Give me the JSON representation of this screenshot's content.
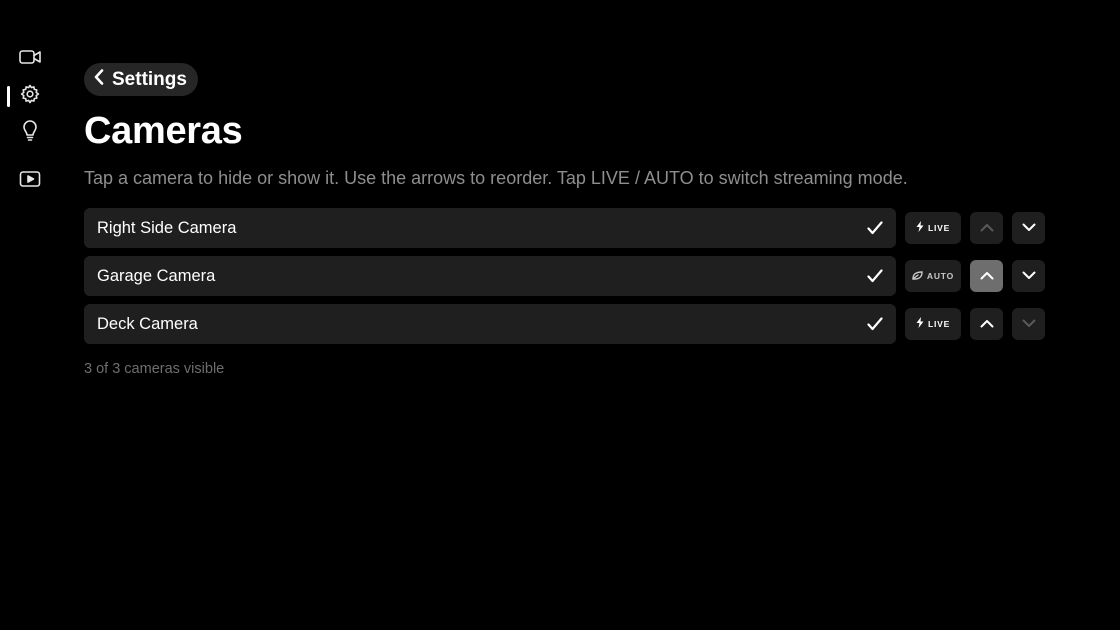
{
  "sidebar": {
    "items": [
      {
        "icon": "video-camera-icon"
      },
      {
        "icon": "gear-icon",
        "selected": true
      },
      {
        "icon": "lightbulb-icon"
      },
      {
        "icon": "play-icon"
      }
    ]
  },
  "header": {
    "back_label": "Settings",
    "title": "Cameras",
    "subtitle": "Tap a camera to hide or show it. Use the arrows to reorder. Tap LIVE / AUTO to switch streaming mode."
  },
  "cameras": [
    {
      "name": "Right Side Camera",
      "visible": true,
      "mode": "LIVE",
      "up_enabled": false,
      "down_enabled": true
    },
    {
      "name": "Garage Camera",
      "visible": true,
      "mode": "AUTO",
      "up_enabled": true,
      "down_enabled": true
    },
    {
      "name": "Deck Camera",
      "visible": true,
      "mode": "LIVE",
      "up_enabled": true,
      "down_enabled": false
    }
  ],
  "footer": {
    "count_text": "3 of 3 cameras visible"
  },
  "colors": {
    "background": "#000000",
    "card": "#1f1f1f",
    "muted_text": "#8e8e8e",
    "focused_button": "#6e6e6e"
  }
}
